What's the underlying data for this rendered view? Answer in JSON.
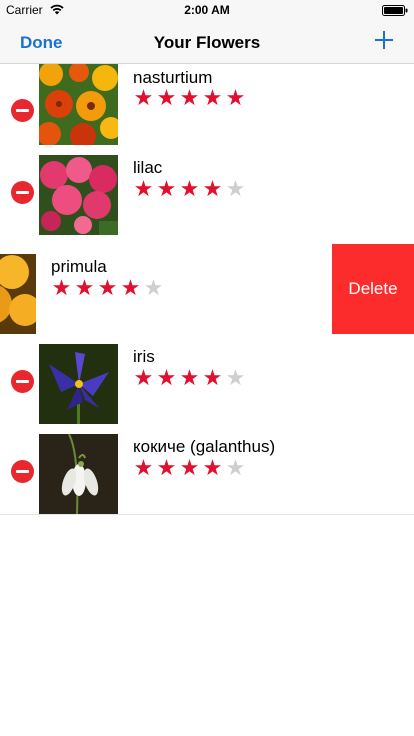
{
  "status_bar": {
    "carrier": "Carrier",
    "time": "2:00 AM",
    "icons": [
      "wifi-icon",
      "battery-icon"
    ]
  },
  "nav_bar": {
    "left_button": "Done",
    "title": "Your Flowers",
    "right_icon": "plus-icon"
  },
  "colors": {
    "tint": "#1a72d6",
    "star_on": "#e0102e",
    "star_off": "#cfcfcf",
    "delete": "#fc2c2c",
    "minus_circle": "#e8272f"
  },
  "flowers": [
    {
      "name": "nasturtium",
      "rating": 5,
      "max_rating": 5
    },
    {
      "name": "lilac",
      "rating": 4,
      "max_rating": 5
    },
    {
      "name": "primula",
      "rating": 4,
      "max_rating": 5,
      "swiped": true
    },
    {
      "name": "iris",
      "rating": 4,
      "max_rating": 5
    },
    {
      "name": "кокиче (galanthus)",
      "rating": 4,
      "max_rating": 5
    }
  ],
  "swipe_action": {
    "label": "Delete"
  }
}
